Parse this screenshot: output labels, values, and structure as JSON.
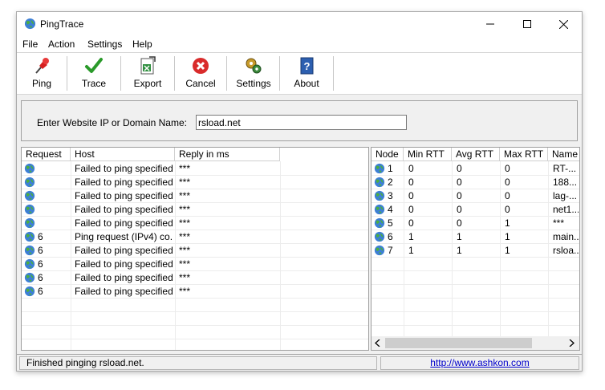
{
  "window": {
    "title": "PingTrace"
  },
  "menu": [
    "File",
    "Action",
    "Settings",
    "Help"
  ],
  "toolbar": [
    {
      "label": "Ping",
      "icon": "pushpin-icon"
    },
    {
      "label": "Trace",
      "icon": "checkmark-icon"
    },
    {
      "label": "Export",
      "icon": "excel-export-icon"
    },
    {
      "label": "Cancel",
      "icon": "cancel-icon"
    },
    {
      "label": "Settings",
      "icon": "gears-icon"
    },
    {
      "label": "About",
      "icon": "help-icon"
    }
  ],
  "input": {
    "label": "Enter Website IP or Domain Name:",
    "value": "rsload.net"
  },
  "ping_table": {
    "columns": [
      "Request",
      "Host",
      "Reply in ms"
    ],
    "rows": [
      {
        "request": "",
        "host": "Failed to ping specified...",
        "reply": "***"
      },
      {
        "request": "",
        "host": "Failed to ping specified...",
        "reply": "***"
      },
      {
        "request": "",
        "host": "Failed to ping specified...",
        "reply": "***"
      },
      {
        "request": "",
        "host": "Failed to ping specified...",
        "reply": "***"
      },
      {
        "request": "",
        "host": "Failed to ping specified...",
        "reply": "***"
      },
      {
        "request": "6",
        "host": "Ping request (IPv4) co...",
        "reply": "***"
      },
      {
        "request": "6",
        "host": "Failed to ping specified...",
        "reply": "***"
      },
      {
        "request": "6",
        "host": "Failed to ping specified...",
        "reply": "***"
      },
      {
        "request": "6",
        "host": "Failed to ping specified...",
        "reply": "***"
      },
      {
        "request": "6",
        "host": "Failed to ping specified...",
        "reply": "***"
      }
    ]
  },
  "trace_table": {
    "columns": [
      "Node",
      "Min RTT",
      "Avg RTT",
      "Max RTT",
      "Name"
    ],
    "rows": [
      {
        "node": "1",
        "min": "0",
        "avg": "0",
        "max": "0",
        "name": "RT-..."
      },
      {
        "node": "2",
        "min": "0",
        "avg": "0",
        "max": "0",
        "name": "188..."
      },
      {
        "node": "3",
        "min": "0",
        "avg": "0",
        "max": "0",
        "name": "lag-..."
      },
      {
        "node": "4",
        "min": "0",
        "avg": "0",
        "max": "0",
        "name": "net1..."
      },
      {
        "node": "5",
        "min": "0",
        "avg": "0",
        "max": "1",
        "name": "***"
      },
      {
        "node": "6",
        "min": "1",
        "avg": "1",
        "max": "1",
        "name": "main..."
      },
      {
        "node": "7",
        "min": "1",
        "avg": "1",
        "max": "1",
        "name": "rsloa..."
      }
    ]
  },
  "status": {
    "message": "Finished pinging rsload.net.",
    "link": "http://www.ashkon.com"
  }
}
